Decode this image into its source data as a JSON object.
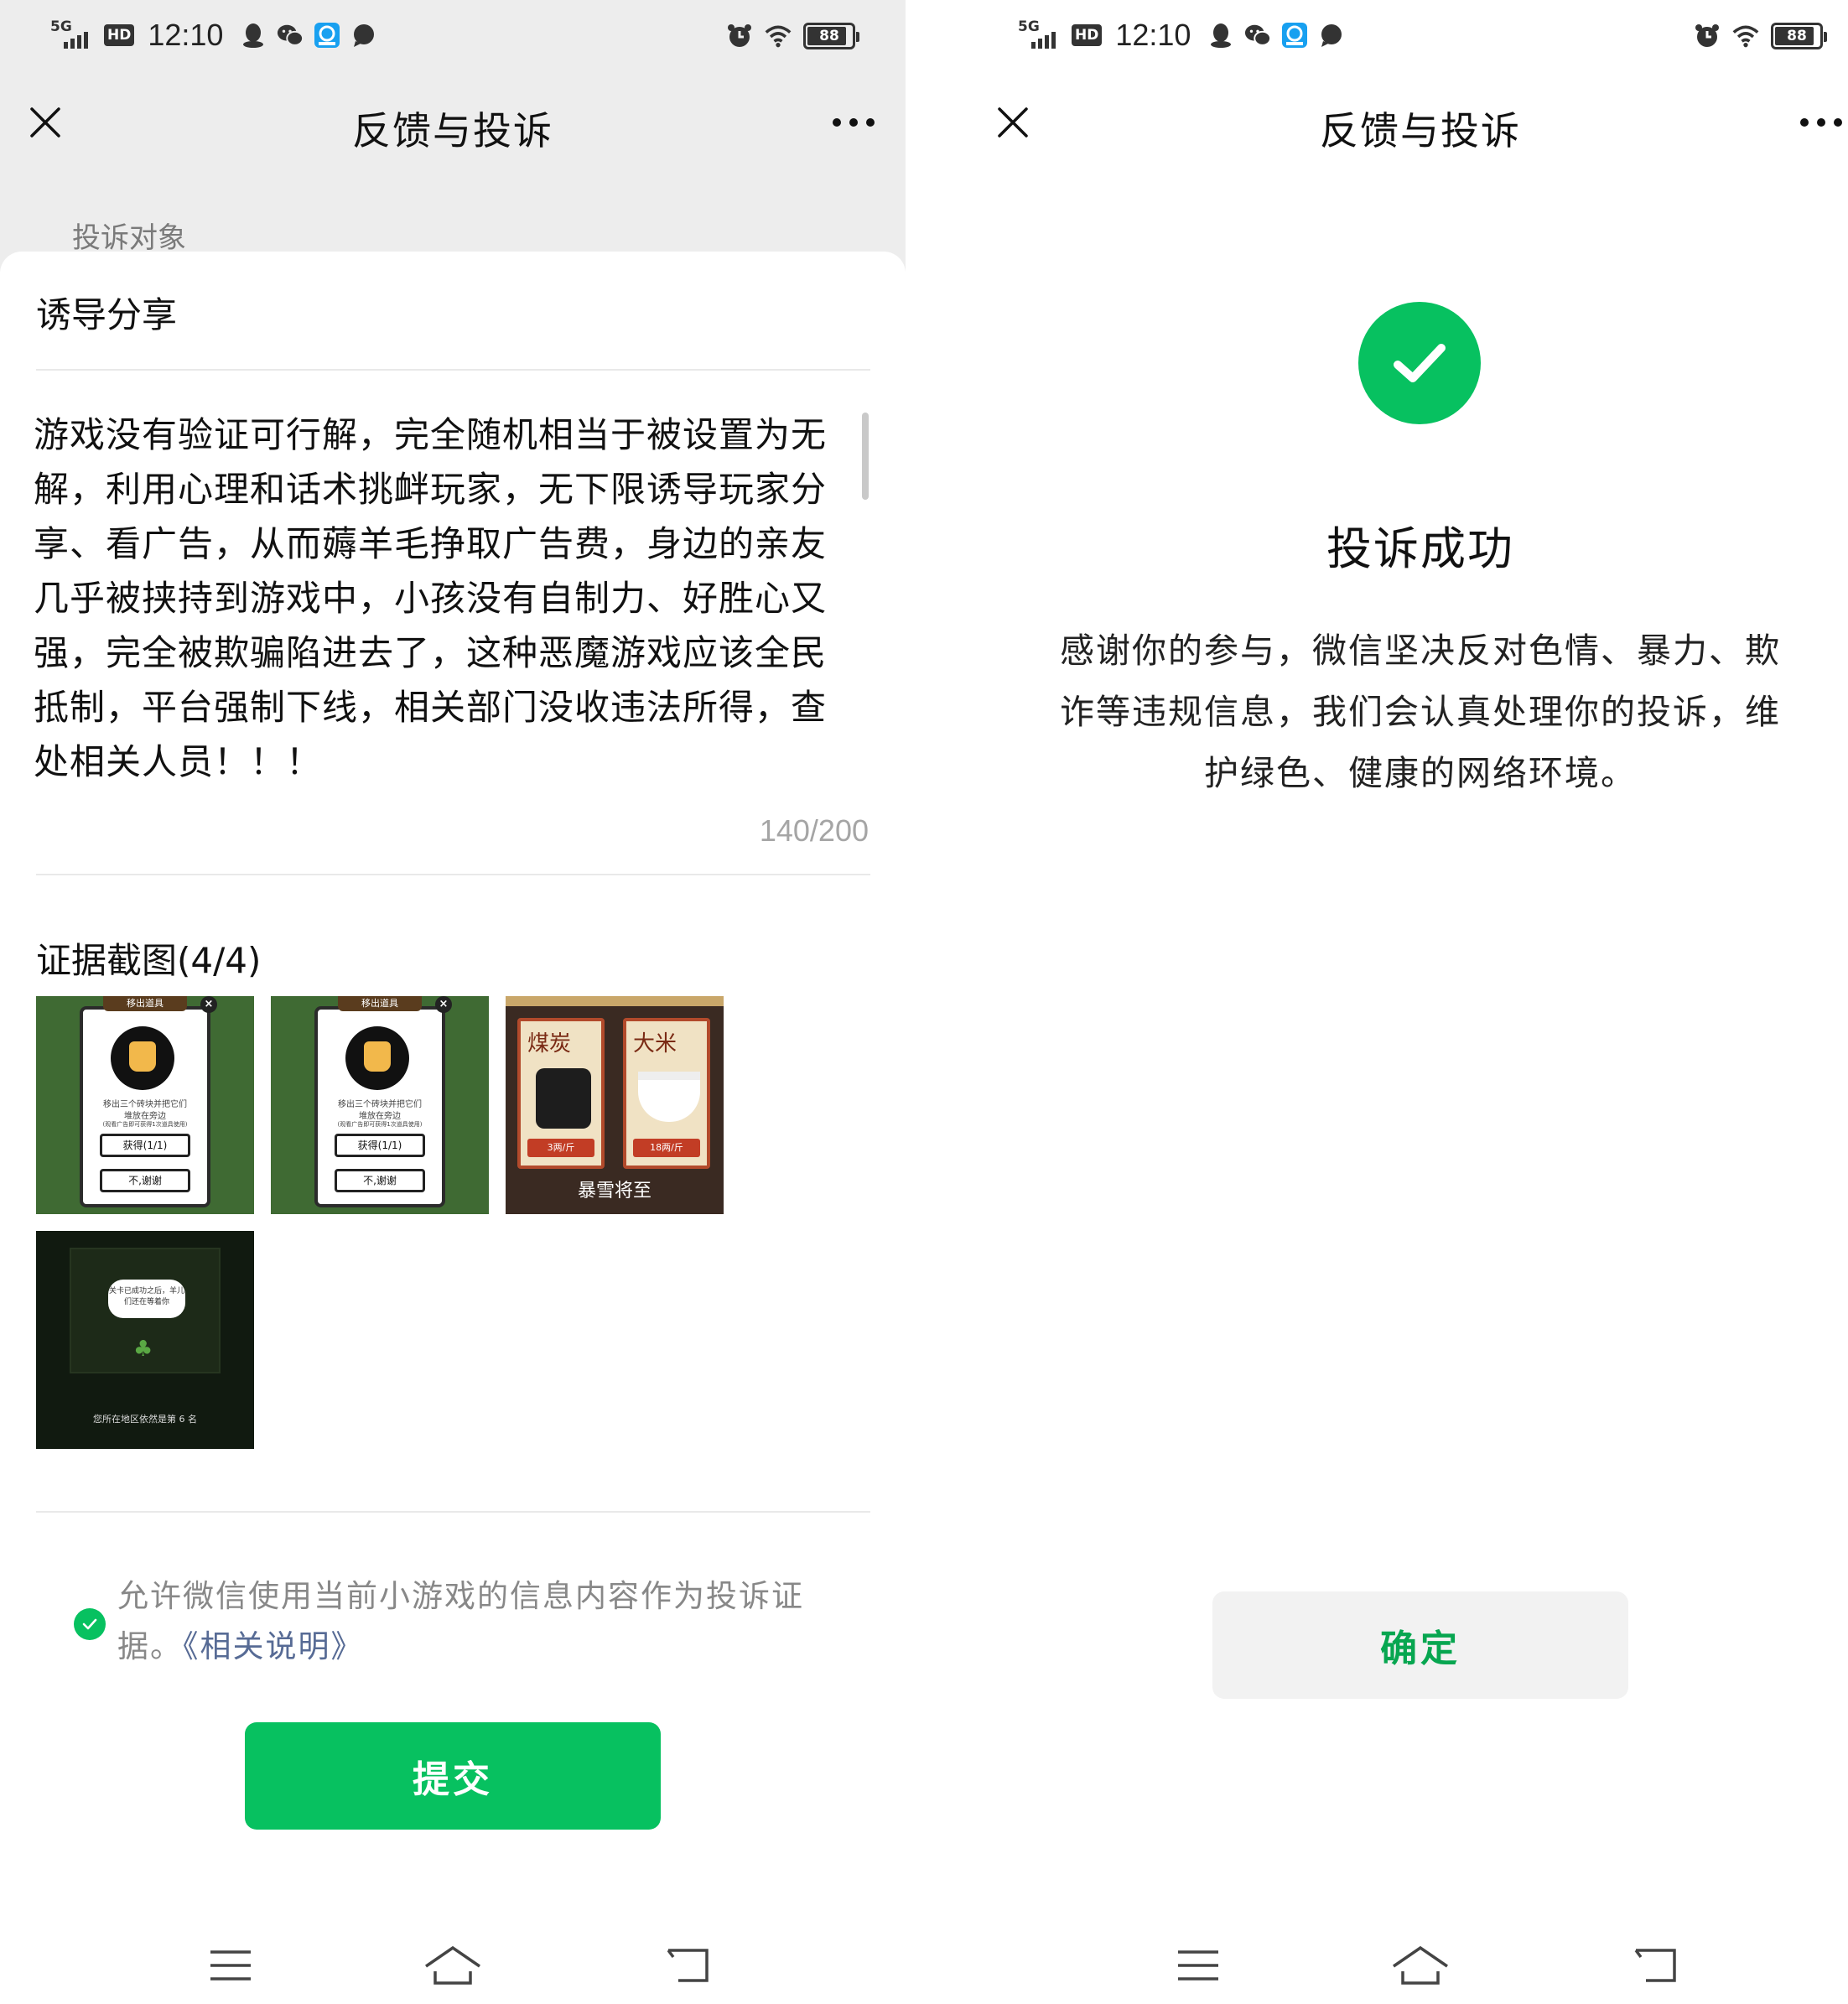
{
  "status_bar": {
    "network": "5G",
    "hd": "HD",
    "time": "12:10",
    "battery": "88",
    "icons": [
      "qq-icon",
      "wechat-icon",
      "app-icon",
      "message-icon",
      "alarm-icon",
      "wifi-icon",
      "battery-icon"
    ]
  },
  "left": {
    "title": "反馈与投诉",
    "section_label": "投诉对象",
    "selected_target": "诱导分享",
    "complaint_text": "游戏没有验证可行解，完全随机相当于被设置为无解，利用心理和话术挑衅玩家，无下限诱导玩家分享、看广告，从而薅羊毛挣取广告费，身边的亲友几乎被挟持到游戏中，小孩没有自制力、好胜心又强，完全被欺骗陷进去了，这种恶魔游戏应该全民抵制，平台强制下线，相关部门没收违法所得，查处相关人员！！！",
    "char_count": "140/200",
    "evidence_title": "证据截图(4/4)",
    "thumbnails": [
      {
        "header": "移出道具",
        "line1": "移出三个砖块并把它们",
        "line2": "堆放在旁边",
        "line3": "(观看广告即可获得1次道具使用)",
        "button1": "获得(1/1)",
        "button2": "不,谢谢"
      },
      {
        "header": "移出道具",
        "line1": "移出三个砖块并把它们",
        "line2": "堆放在旁边",
        "line3": "(观看广告即可获得1次道具使用)",
        "button1": "获得(1/1)",
        "button2": "不,谢谢"
      },
      {
        "item1": "煤炭",
        "price1": "3两/斤",
        "item2": "大米",
        "price2": "18两/斤",
        "caption": "暴雪将至"
      },
      {
        "bubble": "关卡已成功之后，羊儿们还在等着你",
        "rank": "您所在地区依然是第 6 名"
      }
    ],
    "consent_text": "允许微信使用当前小游戏的信息内容作为投诉证据。",
    "consent_link": "《相关说明》",
    "submit_label": "提交"
  },
  "right": {
    "title": "反馈与投诉",
    "success_title": "投诉成功",
    "success_message": "感谢你的参与，微信坚决反对色情、暴力、欺诈等违规信息，我们会认真处理你的投诉，维护绿色、健康的网络环境。",
    "confirm_label": "确定"
  },
  "colors": {
    "accent_green": "#07c160",
    "link_blue": "#576b95",
    "page_gray": "#ededed"
  }
}
